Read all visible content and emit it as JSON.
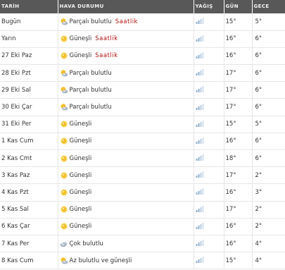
{
  "header": {
    "date": "TARİH",
    "condition": "HAVA DURUMU",
    "rain": "YAĞIŞ",
    "day": "GÜN",
    "night": "GECE"
  },
  "hourly_label": "Saatlik",
  "rows": [
    {
      "date": "Bugün",
      "icon": "partly-cloudy-icon",
      "condition": "Parçalı bulutlu",
      "hourly": true,
      "day": "15°",
      "night": "5°"
    },
    {
      "date": "Yarın",
      "icon": "sunny-icon",
      "condition": "Güneşli",
      "hourly": true,
      "day": "16°",
      "night": "6°"
    },
    {
      "date": "27 Eki Paz",
      "icon": "sunny-icon",
      "condition": "Güneşli",
      "hourly": true,
      "day": "16°",
      "night": "6°"
    },
    {
      "date": "28 Eki Pzt",
      "icon": "partly-cloudy-icon",
      "condition": "Parçalı bulutlu",
      "hourly": false,
      "day": "17°",
      "night": "6°"
    },
    {
      "date": "29 Eki Sal",
      "icon": "partly-cloudy-icon",
      "condition": "Parçalı bulutlu",
      "hourly": false,
      "day": "17°",
      "night": "6°"
    },
    {
      "date": "30 Eki Çar",
      "icon": "partly-cloudy-icon",
      "condition": "Parçalı bulutlu",
      "hourly": false,
      "day": "17°",
      "night": "6°"
    },
    {
      "date": "31 Eki Per",
      "icon": "sunny-icon",
      "condition": "Güneşli",
      "hourly": false,
      "day": "15°",
      "night": "5°"
    },
    {
      "date": "1 Kas Cum",
      "icon": "sunny-icon",
      "condition": "Güneşli",
      "hourly": false,
      "day": "16°",
      "night": "6°"
    },
    {
      "date": "2 Kas Cmt",
      "icon": "sunny-icon",
      "condition": "Güneşli",
      "hourly": false,
      "day": "18°",
      "night": "6°"
    },
    {
      "date": "3 Kas Paz",
      "icon": "sunny-icon",
      "condition": "Güneşli",
      "hourly": false,
      "day": "17°",
      "night": "2°"
    },
    {
      "date": "4 Kas Pzt",
      "icon": "sunny-icon",
      "condition": "Güneşli",
      "hourly": false,
      "day": "16°",
      "night": "3°"
    },
    {
      "date": "5 Kas Sal",
      "icon": "sunny-icon",
      "condition": "Güneşli",
      "hourly": false,
      "day": "17°",
      "night": "2°"
    },
    {
      "date": "6 Kas Çar",
      "icon": "sunny-icon",
      "condition": "Güneşli",
      "hourly": false,
      "day": "16°",
      "night": "2°"
    },
    {
      "date": "7 Kas Per",
      "icon": "cloudy-icon",
      "condition": "Çok bulutlu",
      "hourly": false,
      "day": "16°",
      "night": "4°"
    },
    {
      "date": "8 Kas Cum",
      "icon": "partly-cloudy-icon",
      "condition": "Az bulutlu ve güneşli",
      "hourly": false,
      "day": "15°",
      "night": "4°"
    }
  ],
  "colors": {
    "header_bg": "#585858",
    "link": "#b01010",
    "sun": "#f2c12e",
    "cloud": "#a9b4c0",
    "rain_bars": "#8fb1cf"
  }
}
